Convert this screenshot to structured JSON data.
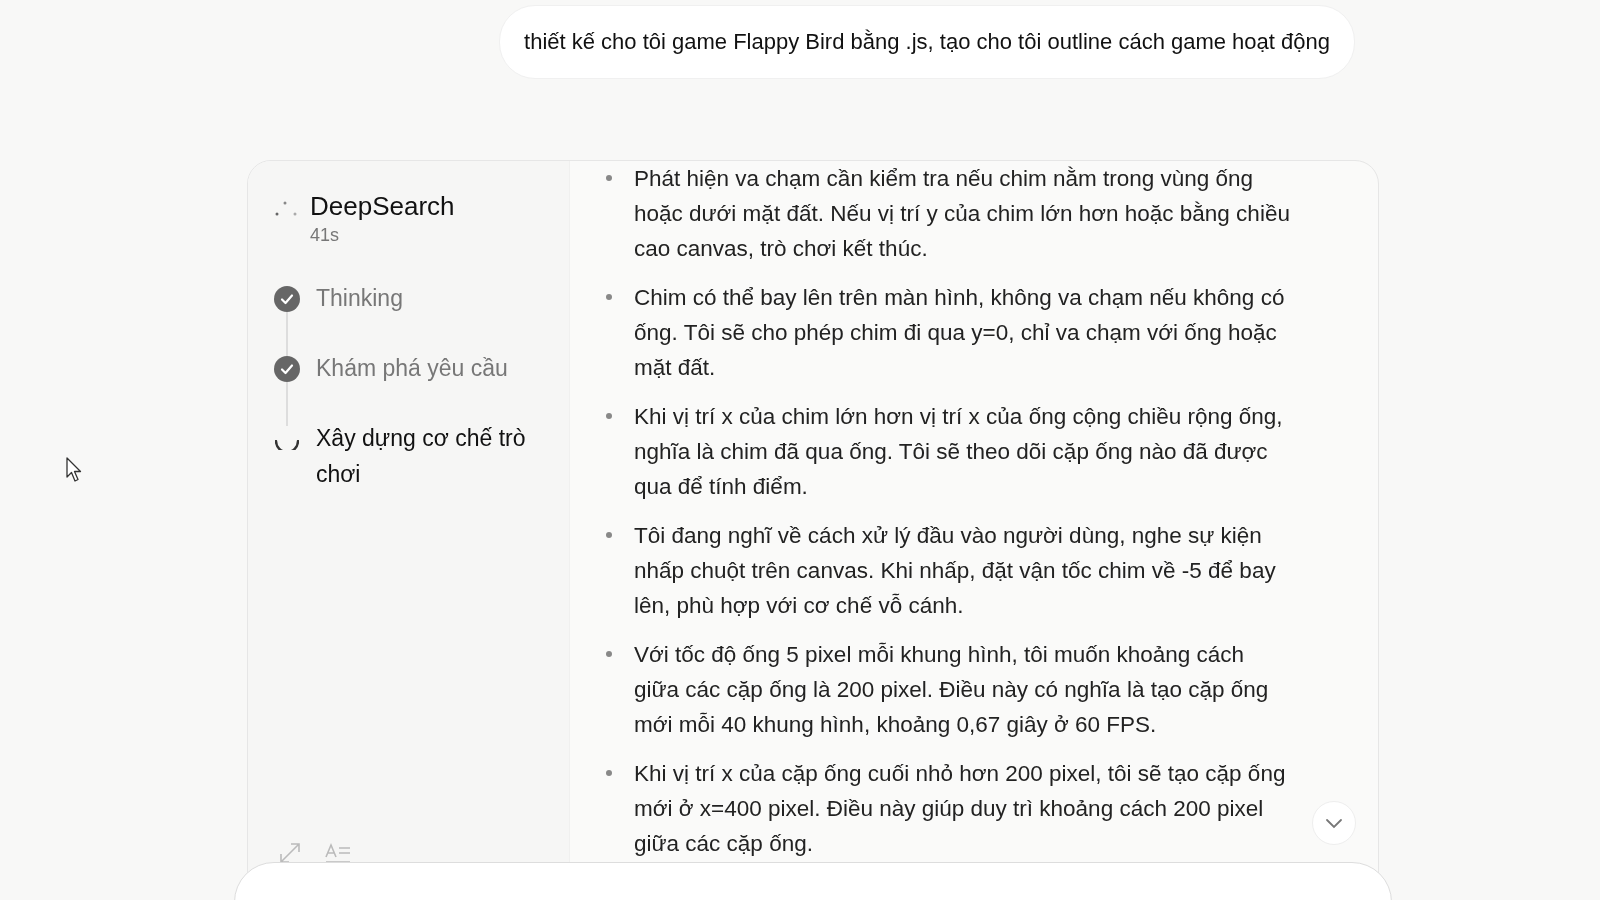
{
  "user_message": "thiết kế cho tôi game Flappy Bird bằng .js, tạo cho tôi outline cách game hoạt động",
  "deepsearch": {
    "title": "DeepSearch",
    "elapsed": "41s",
    "steps": [
      {
        "label": "Thinking",
        "done": true
      },
      {
        "label": "Khám phá yêu cầu",
        "done": true
      },
      {
        "label": "Xây dựng cơ chế trò chơi",
        "done": false
      }
    ]
  },
  "bullets": [
    "Phát hiện va chạm cần kiểm tra nếu chim nằm trong vùng ống hoặc dưới mặt đất. Nếu vị trí y của chim lớn hơn hoặc bằng chiều cao canvas, trò chơi kết thúc.",
    "Chim có thể bay lên trên màn hình, không va chạm nếu không có ống. Tôi sẽ cho phép chim đi qua y=0, chỉ va chạm với ống hoặc mặt đất.",
    "Khi vị trí x của chim lớn hơn vị trí x của ống cộng chiều rộng ống, nghĩa là chim đã qua ống. Tôi sẽ theo dõi cặp ống nào đã được qua để tính điểm.",
    "Tôi đang nghĩ về cách xử lý đầu vào người dùng, nghe sự kiện nhấp chuột trên canvas. Khi nhấp, đặt vận tốc chim về -5 để bay lên, phù hợp với cơ chế vỗ cánh.",
    "Với tốc độ ống 5 pixel mỗi khung hình, tôi muốn khoảng cách giữa các cặp ống là 200 pixel. Điều này có nghĩa là tạo cặp ống mới mỗi 40 khung hình, khoảng 0,67 giây ở 60 FPS.",
    "Khi vị trí x của cặp ống cuối nhỏ hơn 200 pixel, tôi sẽ tạo cặp ống mới ở x=400 pixel. Điều này giúp duy trì khoảng cách 200 pixel giữa các cặp ống."
  ]
}
